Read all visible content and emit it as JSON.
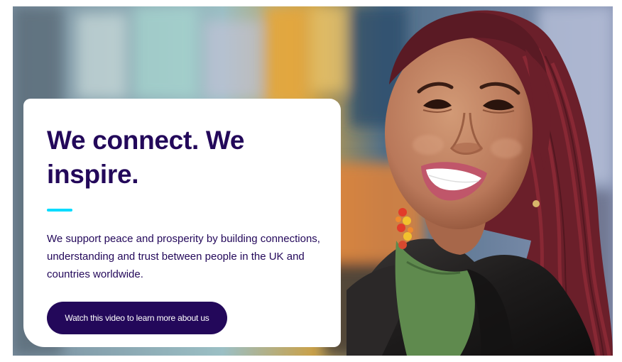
{
  "hero": {
    "headline": "We connect. We inspire.",
    "description": "We support peace and prosperity by building connections, understanding and trust between people in the UK and countries worldwide.",
    "cta_label": "Watch this video to learn more about us",
    "colors": {
      "headline": "#23085a",
      "accent_bar": "#00dcff",
      "button_background": "#23085a",
      "button_text": "#ffffff",
      "card_background": "#ffffff"
    }
  }
}
